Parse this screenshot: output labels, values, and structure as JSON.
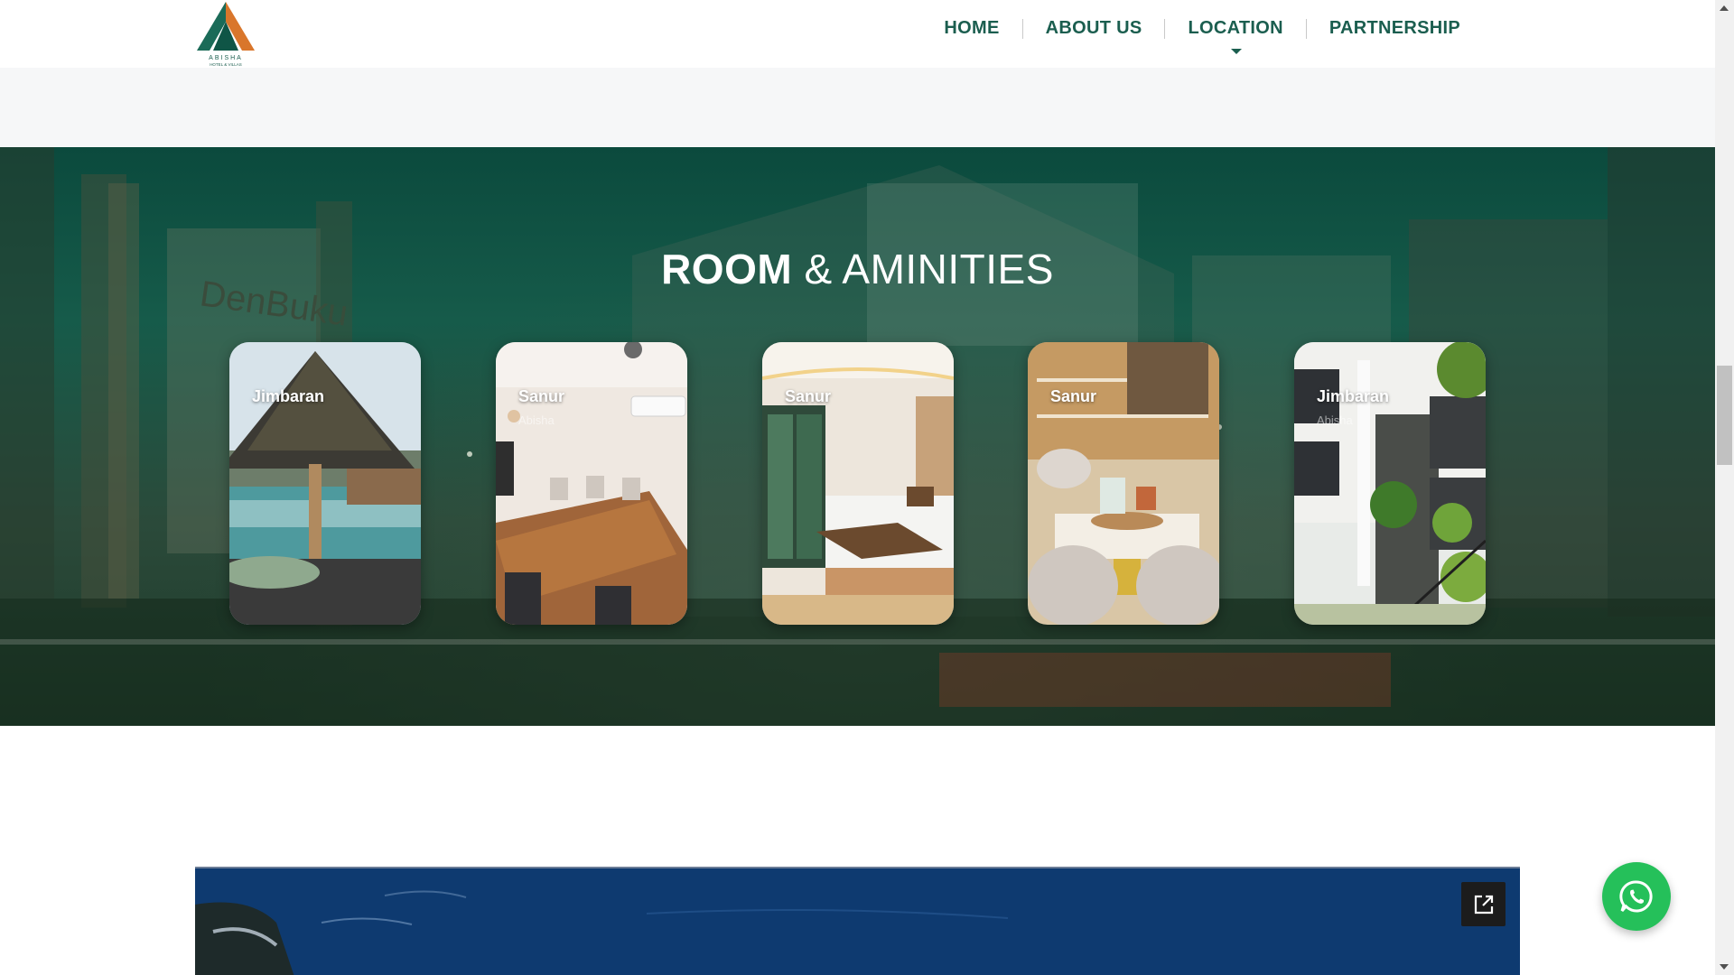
{
  "header": {
    "logo_text": "ABISHA",
    "logo_tagline": "HOTEL & VILLAS",
    "nav": [
      {
        "label": "HOME"
      },
      {
        "label": "ABOUT US"
      },
      {
        "label": "LOCATION"
      },
      {
        "label": "PARTNERSHIP"
      }
    ]
  },
  "rooms": {
    "title_bold": "ROOM",
    "title_light": "& AMINITIES",
    "cards": [
      {
        "title": "Jimbaran",
        "subtitle": ""
      },
      {
        "title": "Sanur",
        "subtitle": "Abisha"
      },
      {
        "title": "Sanur",
        "subtitle": ""
      },
      {
        "title": "Sanur",
        "subtitle": ""
      },
      {
        "title": "Jimbaran",
        "subtitle": "Abisha"
      }
    ]
  },
  "colors": {
    "brand_green": "#1b5e4f",
    "whatsapp_green": "#25c05a"
  },
  "icons": {
    "whatsapp": "whatsapp-icon",
    "expand": "external-link-icon"
  }
}
